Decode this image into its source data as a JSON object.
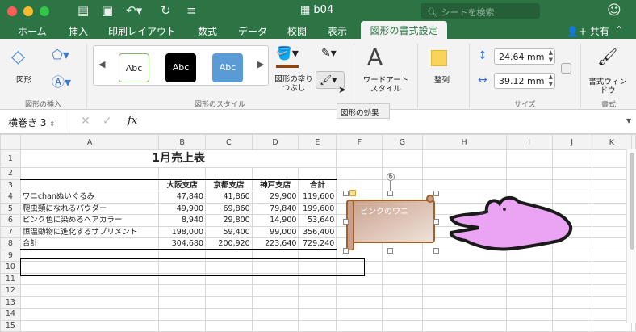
{
  "window": {
    "title": "b04",
    "search_placeholder": "シートを検索"
  },
  "tabs": [
    "ホーム",
    "挿入",
    "印刷レイアウト",
    "数式",
    "データ",
    "校閲",
    "表示",
    "図形の書式設定"
  ],
  "share": "共有",
  "ribbon": {
    "insert_group": "図形の挿入",
    "shape_label": "図形",
    "style_group": "図形のスタイル",
    "styles": [
      "Abc",
      "Abc",
      "Abc"
    ],
    "fill_label": "図形の塗りつぶし",
    "wordart_label": "ワードアートスタイル",
    "arrange_label": "整列",
    "size_group": "サイズ",
    "height": "24.64 mm",
    "width": "39.12 mm",
    "format_group": "書式",
    "format_pane": "書式ウィンドウ",
    "tooltip": "図形の効果"
  },
  "formula_bar": {
    "name_box": "横巻き 3",
    "fx": "fx",
    "value": ""
  },
  "columns": [
    "A",
    "B",
    "C",
    "D",
    "E",
    "F",
    "G",
    "H",
    "I",
    "J",
    "K"
  ],
  "sheet": {
    "title": "1月売上表",
    "headers": [
      "",
      "大阪支店",
      "京都支店",
      "神戸支店",
      "合計"
    ],
    "rows": [
      [
        "ワニchanぬいぐるみ",
        "47,840",
        "41,860",
        "29,900",
        "119,600"
      ],
      [
        "爬虫類になれるパウダー",
        "49,900",
        "69,860",
        "79,840",
        "199,600"
      ],
      [
        "ピンク色に染めるヘアカラー",
        "8,940",
        "29,800",
        "14,900",
        "53,640"
      ],
      [
        "恒温動物に進化するサプリメント",
        "198,000",
        "59,400",
        "99,000",
        "356,400"
      ],
      [
        "合計",
        "304,680",
        "200,920",
        "223,640",
        "729,240"
      ]
    ]
  },
  "shapes": {
    "scroll_text": "ピンクのワニ"
  },
  "colors": {
    "green": "#2d7445",
    "scroll": "#a0612a",
    "croc": "#eaa4f3"
  }
}
